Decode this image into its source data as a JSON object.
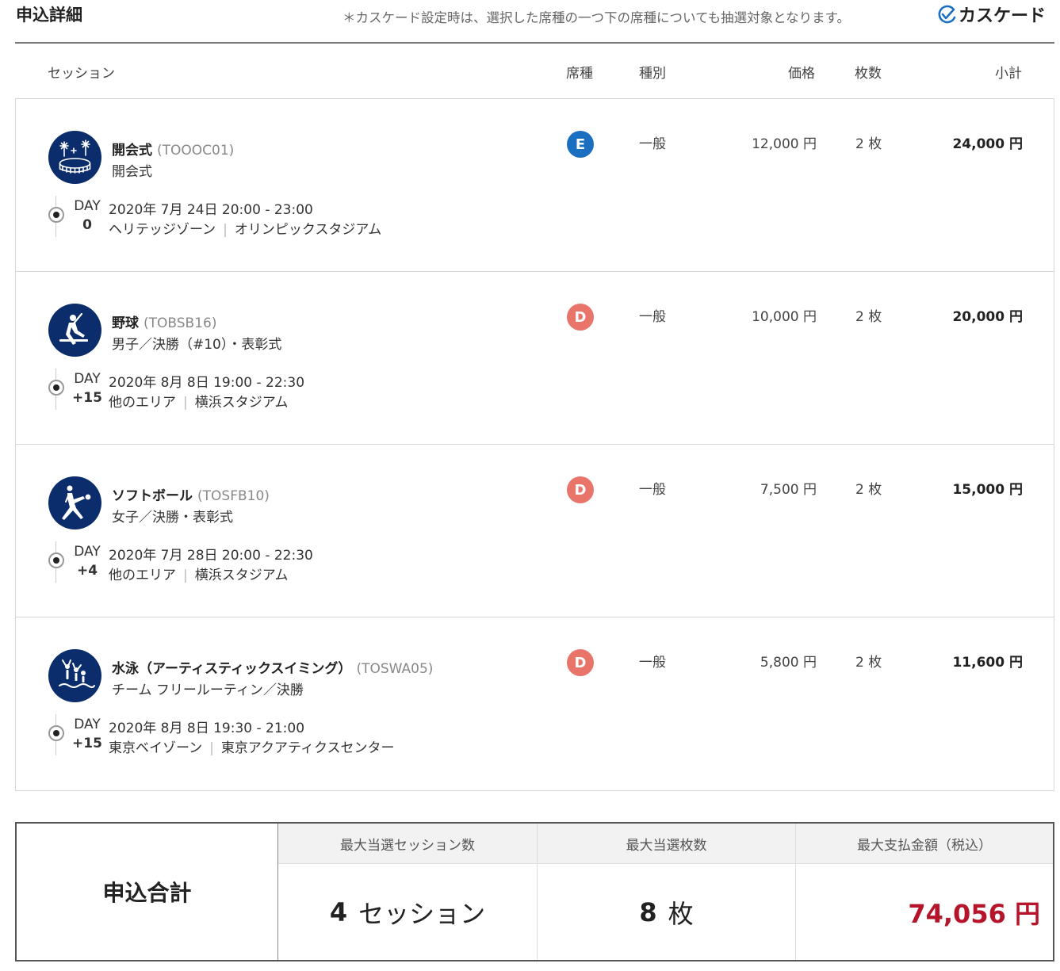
{
  "header": {
    "title": "申込詳細",
    "cascade_note": "＊カスケード設定時は、選択した席種の一つ下の席種についても抽選対象となります。",
    "cascade_label": "カスケード"
  },
  "table": {
    "headers": {
      "session": "セッション",
      "seat": "席種",
      "type": "種別",
      "price": "価格",
      "qty": "枚数",
      "subtotal": "小計"
    },
    "rows": [
      {
        "icon": "opening-ceremony-icon",
        "name": "開会式",
        "code": "(TOOOC01)",
        "subtitle": "開会式",
        "day_label": "DAY",
        "day_offset": "0",
        "datetime": "2020年 7月 24日 20:00 - 23:00",
        "zone": "ヘリテッジゾーン",
        "venue": "オリンピックスタジアム",
        "seat": "E",
        "seat_color": "#1a6fc1",
        "type": "一般",
        "price": "12,000 円",
        "qty": "2 枚",
        "subtotal": "24,000 円"
      },
      {
        "icon": "baseball-icon",
        "name": "野球",
        "code": "(TOBSB16)",
        "subtitle": "男子／決勝（#10）・表彰式",
        "day_label": "DAY",
        "day_offset": "+15",
        "datetime": "2020年 8月 8日 19:00 - 22:30",
        "zone": "他のエリア",
        "venue": "横浜スタジアム",
        "seat": "D",
        "seat_color": "#e8746a",
        "type": "一般",
        "price": "10,000 円",
        "qty": "2 枚",
        "subtotal": "20,000 円"
      },
      {
        "icon": "softball-icon",
        "name": "ソフトボール",
        "code": "(TOSFB10)",
        "subtitle": "女子／決勝・表彰式",
        "day_label": "DAY",
        "day_offset": "+4",
        "datetime": "2020年 7月 28日 20:00 - 22:30",
        "zone": "他のエリア",
        "venue": "横浜スタジアム",
        "seat": "D",
        "seat_color": "#e8746a",
        "type": "一般",
        "price": "7,500 円",
        "qty": "2 枚",
        "subtotal": "15,000 円"
      },
      {
        "icon": "artistic-swimming-icon",
        "name": "水泳（アーティスティックスイミング）",
        "code": "(TOSWA05)",
        "subtitle": "チーム フリールーティン／決勝",
        "day_label": "DAY",
        "day_offset": "+15",
        "datetime": "2020年 8月 8日 19:30 - 21:00",
        "zone": "東京ベイゾーン",
        "venue": "東京アクアティクスセンター",
        "seat": "D",
        "seat_color": "#e8746a",
        "type": "一般",
        "price": "5,800 円",
        "qty": "2 枚",
        "subtotal": "11,600 円"
      }
    ]
  },
  "totals": {
    "label": "申込合計",
    "sessions_header": "最大当選セッション数",
    "sessions_value": "4",
    "sessions_unit": "セッション",
    "tickets_header": "最大当選枚数",
    "tickets_value": "8",
    "tickets_unit": "枚",
    "amount_header": "最大支払金額（税込）",
    "amount_value": "74,056 円"
  },
  "colors": {
    "accent_blue": "#1a6fc1",
    "icon_navy": "#0b2d6b",
    "seat_d": "#e8746a",
    "total_red": "#b5142a"
  }
}
